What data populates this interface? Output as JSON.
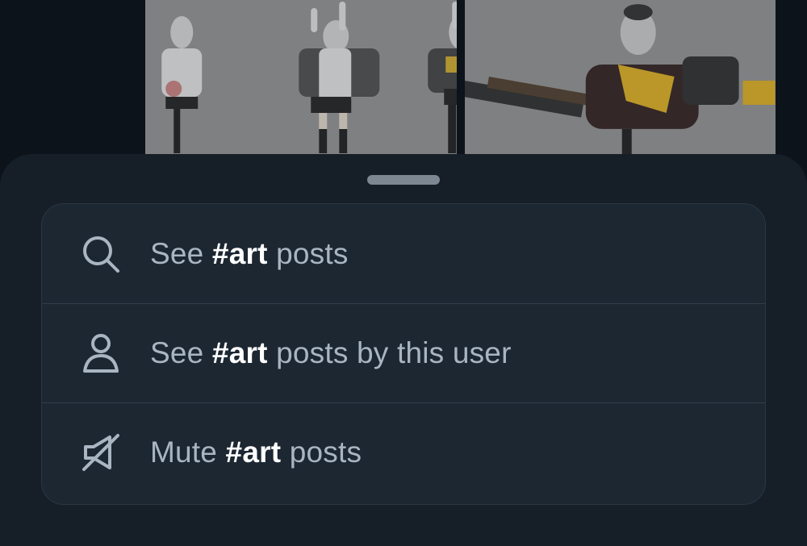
{
  "post": {
    "images": [
      {
        "alt": ""
      },
      {
        "alt": ""
      }
    ]
  },
  "sheet": {
    "items": [
      {
        "icon": "search-icon",
        "prefix": "See ",
        "hashtag": "#art",
        "suffix": " posts"
      },
      {
        "icon": "person-icon",
        "prefix": "See ",
        "hashtag": "#art",
        "suffix": " posts by this user"
      },
      {
        "icon": "mute-icon",
        "prefix": "Mute ",
        "hashtag": "#art",
        "suffix": " posts"
      }
    ]
  },
  "colors": {
    "page_background": "#0c131b",
    "sheet_background": "#161f28",
    "menu_background": "#1c2732",
    "text_secondary": "#a9b6c2",
    "text_hashtag": "#ffffff",
    "divider": "#303e4b"
  }
}
